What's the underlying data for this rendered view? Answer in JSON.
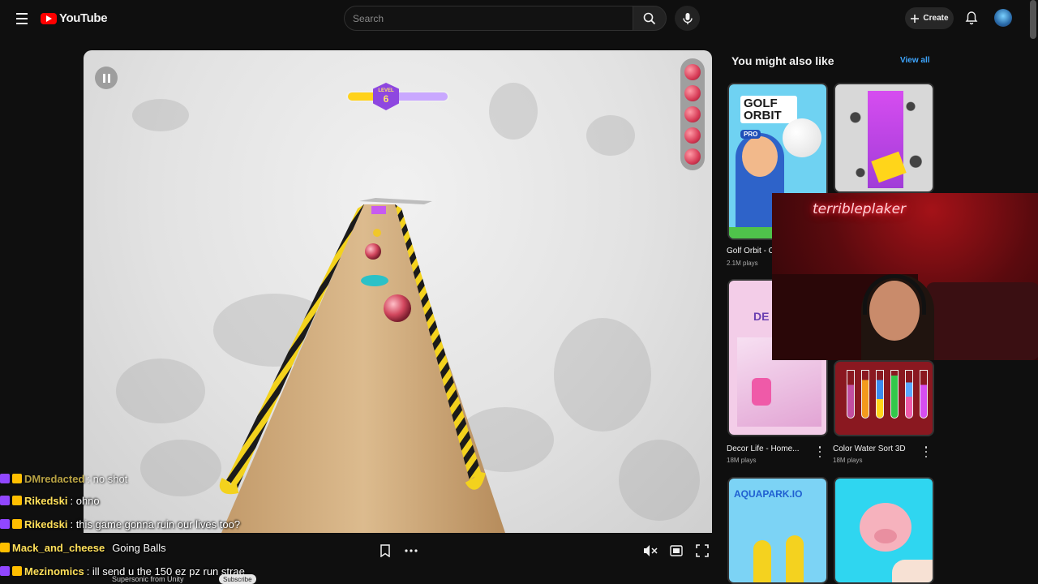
{
  "header": {
    "logo_text": "YouTube",
    "search_placeholder": "Search",
    "create_label": "Create"
  },
  "game": {
    "level_label": "LEVEL",
    "level_number": "6",
    "lives_remaining": 5,
    "level_progress": 0.45
  },
  "player": {
    "controls": [
      "bookmark-icon",
      "more-icon",
      "mute-icon",
      "theater-icon",
      "fullscreen-icon"
    ]
  },
  "sidebar": {
    "title": "You might also like",
    "view_all": "View all",
    "cards": [
      {
        "title": "Golf Orbit - Oi",
        "plays": "2.1M plays",
        "thumb_text": "GOLF ORBIT",
        "badge": "PRO"
      },
      {
        "title": "",
        "plays": "",
        "thumb_text": ""
      },
      {
        "title": "Decor Life - Home...",
        "plays": "18M plays",
        "thumb_text": "DE"
      },
      {
        "title": "Color Water Sort 3D",
        "plays": "18M plays",
        "thumb_text": ""
      },
      {
        "title": "",
        "plays": "",
        "thumb_text": "AQUAPARK.IO"
      },
      {
        "title": "",
        "plays": "",
        "thumb_text": ""
      }
    ]
  },
  "webcam": {
    "neon_sign": "terribleplaker"
  },
  "chat": {
    "messages": [
      {
        "user": "DMredacted",
        "text": ": no shot"
      },
      {
        "user": "Rikedski",
        "text": ": ohno"
      },
      {
        "user": "Rikedski",
        "text": ": this game gonna ruin our lives too?"
      },
      {
        "user": "Mack_and_cheese",
        "text": "Going Balls"
      },
      {
        "user": "Mezinomics",
        "text": ": ill send u the 150 ez pz run strae"
      }
    ],
    "footer_text": "Supersonic from Unity",
    "subscribe_label": "Subscribe"
  },
  "colors": {
    "youtube_red": "#ff0000",
    "chat_name": "#ffe05a",
    "link_blue": "#3ea6ff"
  }
}
